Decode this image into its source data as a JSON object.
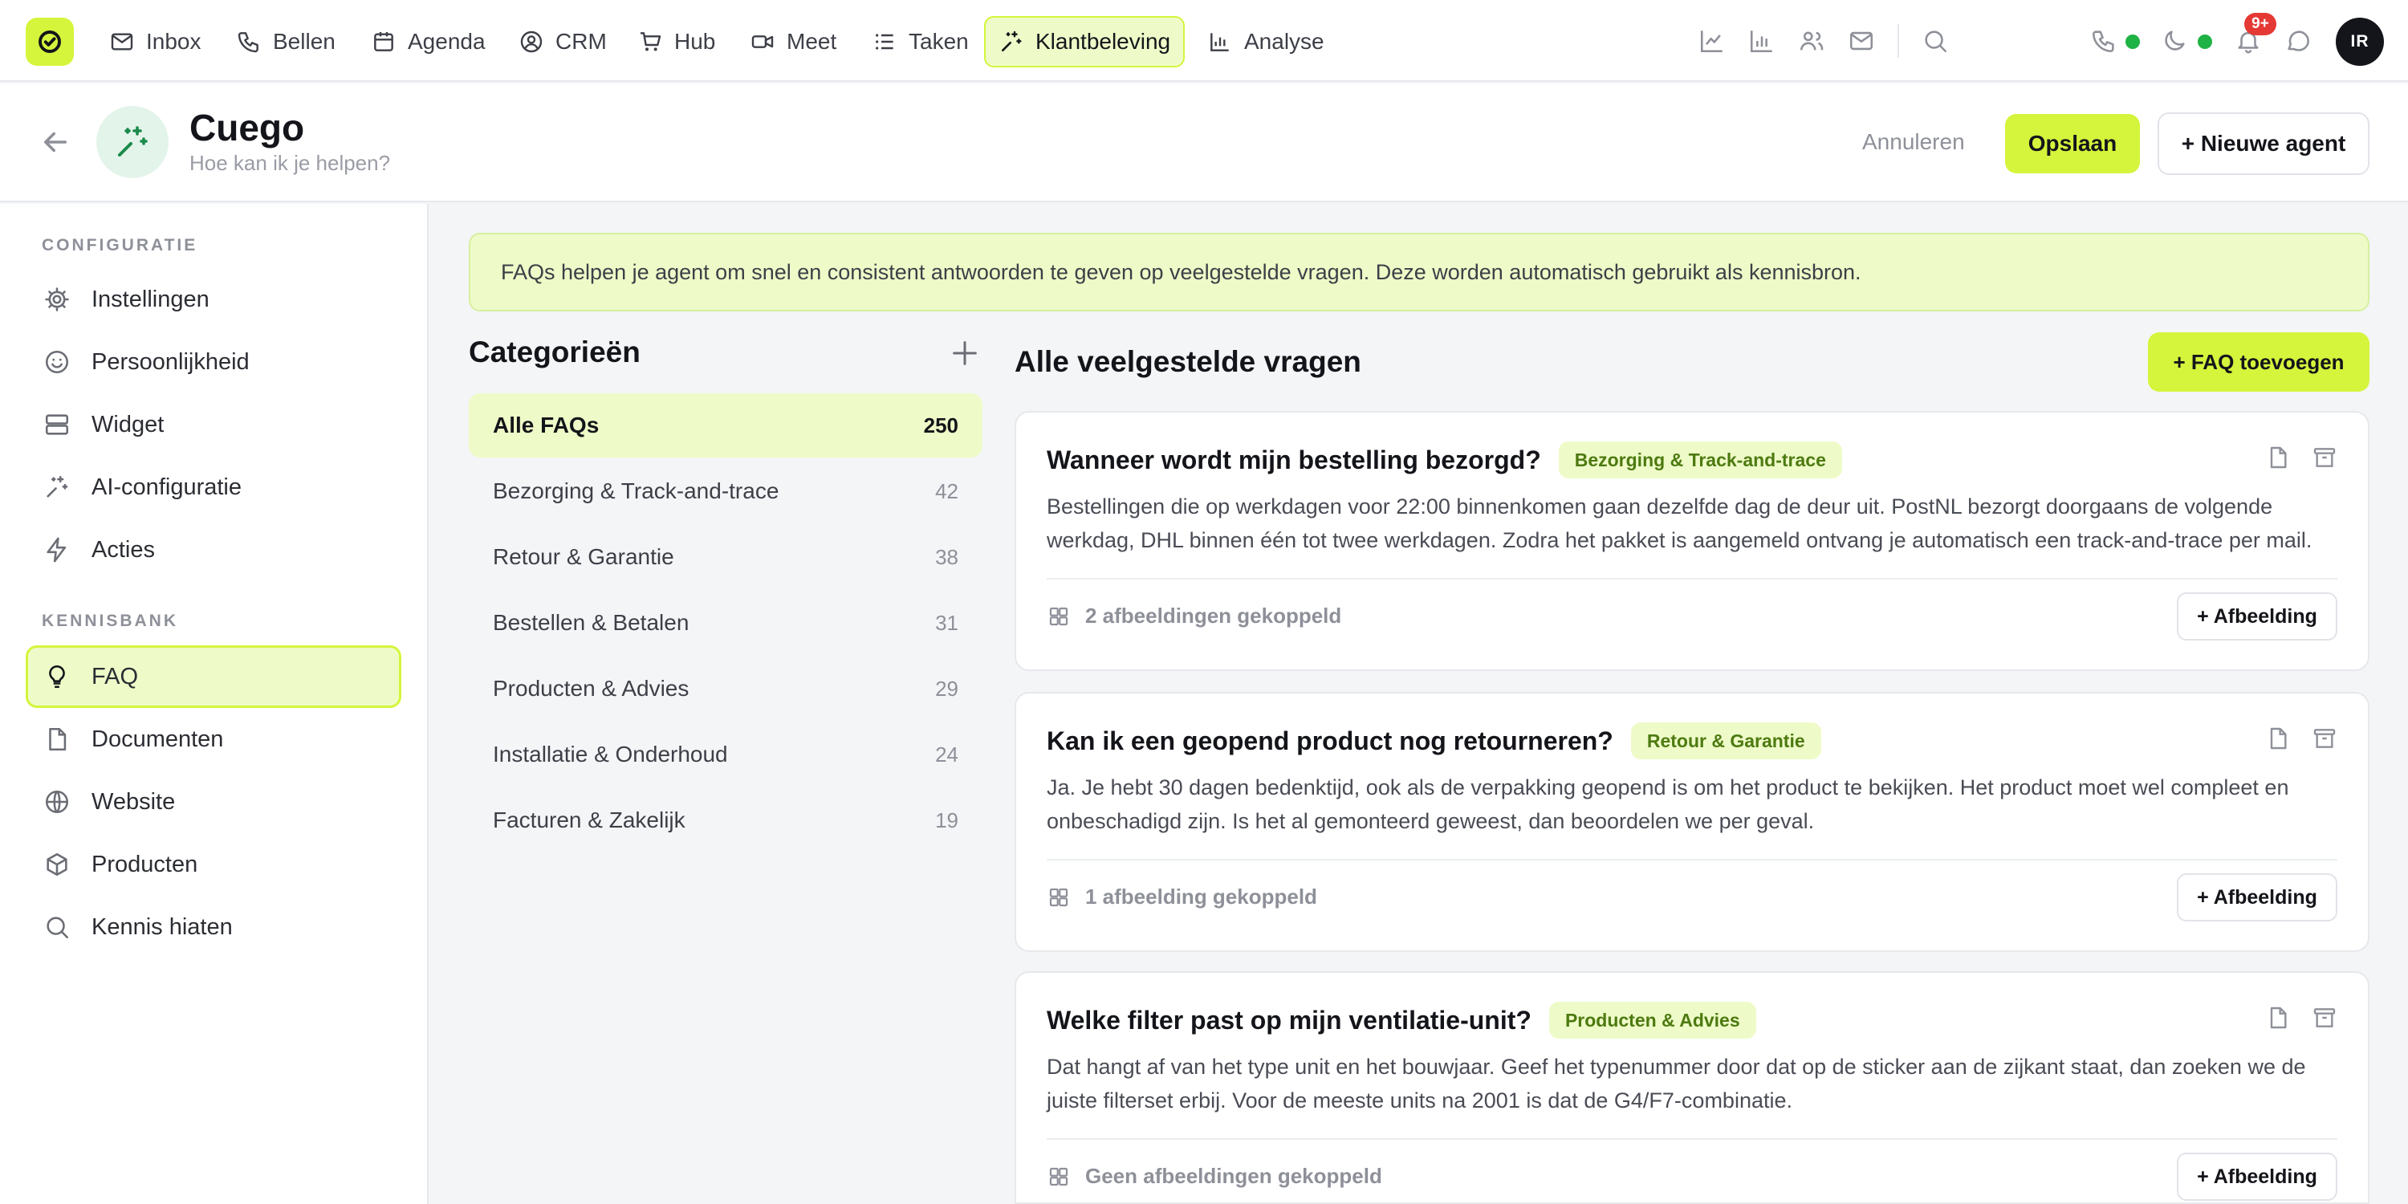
{
  "colors": {
    "accent": "#d4f53c",
    "accent_soft": "#eefbc8",
    "status_online": "#1fb244",
    "badge": "#e53935"
  },
  "topbar": {
    "nav": [
      {
        "label": "Inbox",
        "icon": "mail-icon"
      },
      {
        "label": "Bellen",
        "icon": "phone-icon"
      },
      {
        "label": "Agenda",
        "icon": "calendar-icon"
      },
      {
        "label": "CRM",
        "icon": "user-circle-icon"
      },
      {
        "label": "Hub",
        "icon": "cart-icon"
      },
      {
        "label": "Meet",
        "icon": "video-icon"
      },
      {
        "label": "Taken",
        "icon": "list-icon"
      },
      {
        "label": "Klantbeleving",
        "icon": "sparkle-icon",
        "active": true
      },
      {
        "label": "Analyse",
        "icon": "bar-chart-icon"
      }
    ],
    "notification_count": "9+",
    "avatar_initials": "IR"
  },
  "header": {
    "agent_name": "Cuego",
    "agent_subtitle": "Hoe kan ik je helpen?",
    "cancel_label": "Annuleren",
    "save_label": "Opslaan",
    "new_agent_label": "+ Nieuwe agent"
  },
  "sidebar": {
    "sections": [
      {
        "title": "CONFIGURATIE",
        "items": [
          {
            "label": "Instellingen",
            "icon": "gear-icon"
          },
          {
            "label": "Persoonlijkheid",
            "icon": "smiley-icon"
          },
          {
            "label": "Widget",
            "icon": "widget-icon"
          },
          {
            "label": "AI-configuratie",
            "icon": "sparkle-icon"
          },
          {
            "label": "Acties",
            "icon": "lightning-icon"
          }
        ]
      },
      {
        "title": "KENNISBANK",
        "items": [
          {
            "label": "FAQ",
            "icon": "lightbulb-icon",
            "active": true
          },
          {
            "label": "Documenten",
            "icon": "document-icon"
          },
          {
            "label": "Website",
            "icon": "globe-icon"
          },
          {
            "label": "Producten",
            "icon": "box-icon"
          },
          {
            "label": "Kennis hiaten",
            "icon": "search-icon"
          }
        ]
      }
    ]
  },
  "main": {
    "info_text": "FAQs helpen je agent om snel en consistent antwoorden te geven op veelgestelde vragen. Deze worden automatisch gebruikt als kennisbron.",
    "categories_title": "Categorieën",
    "categories": [
      {
        "label": "Alle FAQs",
        "count": "250",
        "active": true
      },
      {
        "label": "Bezorging & Track-and-trace",
        "count": "42"
      },
      {
        "label": "Retour & Garantie",
        "count": "38"
      },
      {
        "label": "Bestellen & Betalen",
        "count": "31"
      },
      {
        "label": "Producten & Advies",
        "count": "29"
      },
      {
        "label": "Installatie & Onderhoud",
        "count": "24"
      },
      {
        "label": "Facturen & Zakelijk",
        "count": "19"
      }
    ],
    "faq_title": "Alle veelgestelde vragen",
    "add_faq_label": "+ FAQ toevoegen",
    "faqs": [
      {
        "question": "Wanneer wordt mijn bestelling bezorgd?",
        "category": "Bezorging & Track-and-trace",
        "answer": "Bestellingen die op werkdagen voor 22:00 binnenkomen gaan dezelfde dag de deur uit. PostNL bezorgt doorgaans de volgende werkdag, DHL binnen één tot twee werkdagen. Zodra het pakket is aangemeld ontvang je automatisch een track-and-trace per mail.",
        "images_text": "2 afbeeldingen gekoppeld",
        "add_image_label": "+ Afbeelding"
      },
      {
        "question": "Kan ik een geopend product nog retourneren?",
        "category": "Retour & Garantie",
        "answer": "Ja. Je hebt 30 dagen bedenktijd, ook als de verpakking geopend is om het product te bekijken. Het product moet wel compleet en onbeschadigd zijn. Is het al gemonteerd geweest, dan beoordelen we per geval.",
        "images_text": "1 afbeelding gekoppeld",
        "add_image_label": "+ Afbeelding"
      },
      {
        "question": "Welke filter past op mijn ventilatie-unit?",
        "category": "Producten & Advies",
        "answer": "Dat hangt af van het type unit en het bouwjaar. Geef het typenummer door dat op de sticker aan de zijkant staat, dan zoeken we de juiste filterset erbij. Voor de meeste units na 2001 is dat de G4/F7-combinatie.",
        "images_text": "Geen afbeeldingen gekoppeld",
        "add_image_label": "+ Afbeelding"
      }
    ]
  }
}
